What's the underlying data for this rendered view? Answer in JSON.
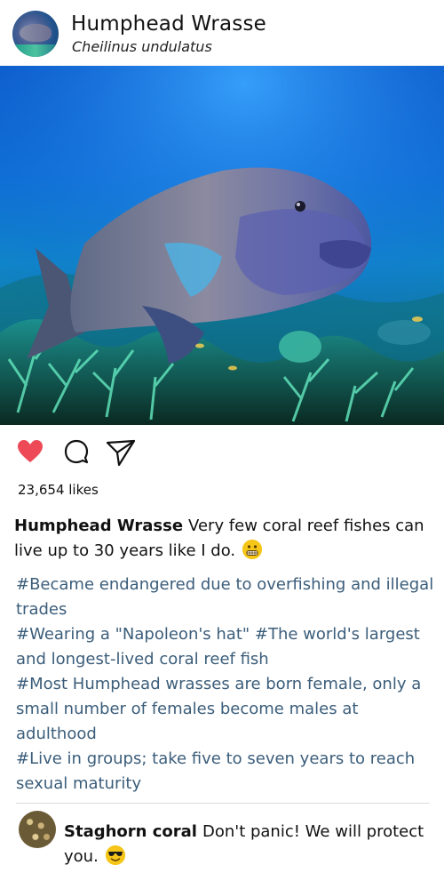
{
  "post": {
    "account_name": "Humphead Wrasse",
    "account_subtitle": "Cheilinus undulatus",
    "likes": "23,654 likes",
    "caption_user": "Humphead Wrasse",
    "caption_text": "Very few coral reef fishes can live up to 30 years like I do.",
    "caption_emoji": "grimacing-face-emoji",
    "hashtags": [
      "#Became endangered due to overfishing and illegal trades",
      "#Wearing a \"Napoleon's hat\"  #The world's largest and longest-lived coral reef fish",
      "#Most Humphead wrasses are born female, only a small number of females become males at adulthood",
      "#Live in groups; take five to seven years to reach sexual maturity"
    ]
  },
  "actions": {
    "like_icon": "heart-icon",
    "like_color": "#ed4956",
    "comment_icon": "comment-icon",
    "share_icon": "send-icon"
  },
  "comment": {
    "user": "Staghorn coral",
    "text": "Don't panic! We will protect you.",
    "emoji": "smiling-face-with-sunglasses-emoji"
  },
  "colors": {
    "hashtag": "#3b5d7a",
    "emoji_yellow": "#f5c518"
  }
}
